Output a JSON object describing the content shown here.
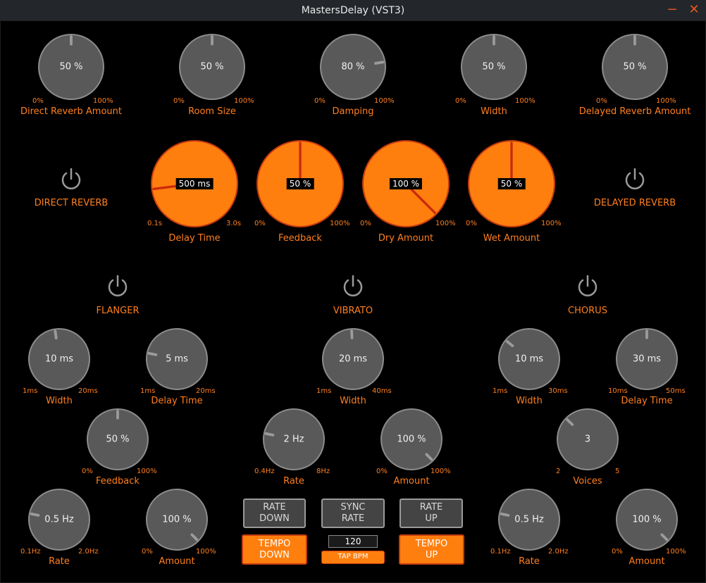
{
  "window": {
    "title": "MastersDelay (VST3)",
    "minimize": "−",
    "close": "✕"
  },
  "reverb": {
    "direct_amount": {
      "value": "50 %",
      "min": "0%",
      "max": "100%",
      "label": "Direct Reverb Amount",
      "fraction": 0.5
    },
    "room_size": {
      "value": "50 %",
      "min": "0%",
      "max": "100%",
      "label": "Room Size",
      "fraction": 0.5
    },
    "damping": {
      "value": "80 %",
      "min": "0%",
      "max": "100%",
      "label": "Damping",
      "fraction": 0.8
    },
    "width": {
      "value": "50 %",
      "min": "0%",
      "max": "100%",
      "label": "Width",
      "fraction": 0.5
    },
    "delayed_amount": {
      "value": "50 %",
      "min": "0%",
      "max": "100%",
      "label": "Delayed Reverb Amount",
      "fraction": 0.5
    },
    "direct_toggle_label": "DIRECT REVERB",
    "delayed_toggle_label": "DELAYED REVERB"
  },
  "delay": {
    "time": {
      "value": "500 ms",
      "min": "0.1s",
      "max": "3.0s",
      "label": "Delay Time",
      "fraction": 0.14
    },
    "feedback": {
      "value": "50 %",
      "min": "0%",
      "max": "100%",
      "label": "Feedback",
      "fraction": 0.5
    },
    "dry": {
      "value": "100 %",
      "min": "0%",
      "max": "100%",
      "label": "Dry Amount",
      "fraction": 1.0
    },
    "wet": {
      "value": "50 %",
      "min": "0%",
      "max": "100%",
      "label": "Wet Amount",
      "fraction": 0.5
    }
  },
  "flanger": {
    "title": "FLANGER",
    "width": {
      "value": "10 ms",
      "min": "1ms",
      "max": "20ms",
      "label": "Width",
      "fraction": 0.47
    },
    "delay_time": {
      "value": "5 ms",
      "min": "1ms",
      "max": "20ms",
      "label": "Delay Time",
      "fraction": 0.21
    },
    "feedback": {
      "value": "50 %",
      "min": "0%",
      "max": "100%",
      "label": "Feedback",
      "fraction": 0.5
    },
    "rate": {
      "value": "0.5 Hz",
      "min": "0.1Hz",
      "max": "2.0Hz",
      "label": "Rate",
      "fraction": 0.21
    },
    "amount": {
      "value": "100 %",
      "min": "0%",
      "max": "100%",
      "label": "Amount",
      "fraction": 1.0
    }
  },
  "vibrato": {
    "title": "VIBRATO",
    "width": {
      "value": "20 ms",
      "min": "1ms",
      "max": "40ms",
      "label": "Width",
      "fraction": 0.49
    },
    "rate": {
      "value": "2 Hz",
      "min": "0.4Hz",
      "max": "8Hz",
      "label": "Rate",
      "fraction": 0.21
    },
    "amount": {
      "value": "100 %",
      "min": "0%",
      "max": "100%",
      "label": "Amount",
      "fraction": 1.0
    }
  },
  "chorus": {
    "title": "CHORUS",
    "width": {
      "value": "10 ms",
      "min": "1ms",
      "max": "30ms",
      "label": "Width",
      "fraction": 0.31
    },
    "delay_time": {
      "value": "30 ms",
      "min": "10ms",
      "max": "50ms",
      "label": "Delay Time",
      "fraction": 0.5
    },
    "voices": {
      "value": "3",
      "min": "2",
      "max": "5",
      "label": "Voices",
      "fraction": 0.33
    },
    "rate": {
      "value": "0.5 Hz",
      "min": "0.1Hz",
      "max": "2.0Hz",
      "label": "Rate",
      "fraction": 0.21
    },
    "amount": {
      "value": "100 %",
      "min": "0%",
      "max": "100%",
      "label": "Amount",
      "fraction": 1.0
    }
  },
  "controls": {
    "rate_down": "RATE\nDOWN",
    "sync_rate": "SYNC\nRATE",
    "rate_up": "RATE\nUP",
    "tempo_down": "TEMPO\nDOWN",
    "tempo_up": "TEMPO\nUP",
    "bpm": "120",
    "tap_bpm": "TAP BPM"
  }
}
